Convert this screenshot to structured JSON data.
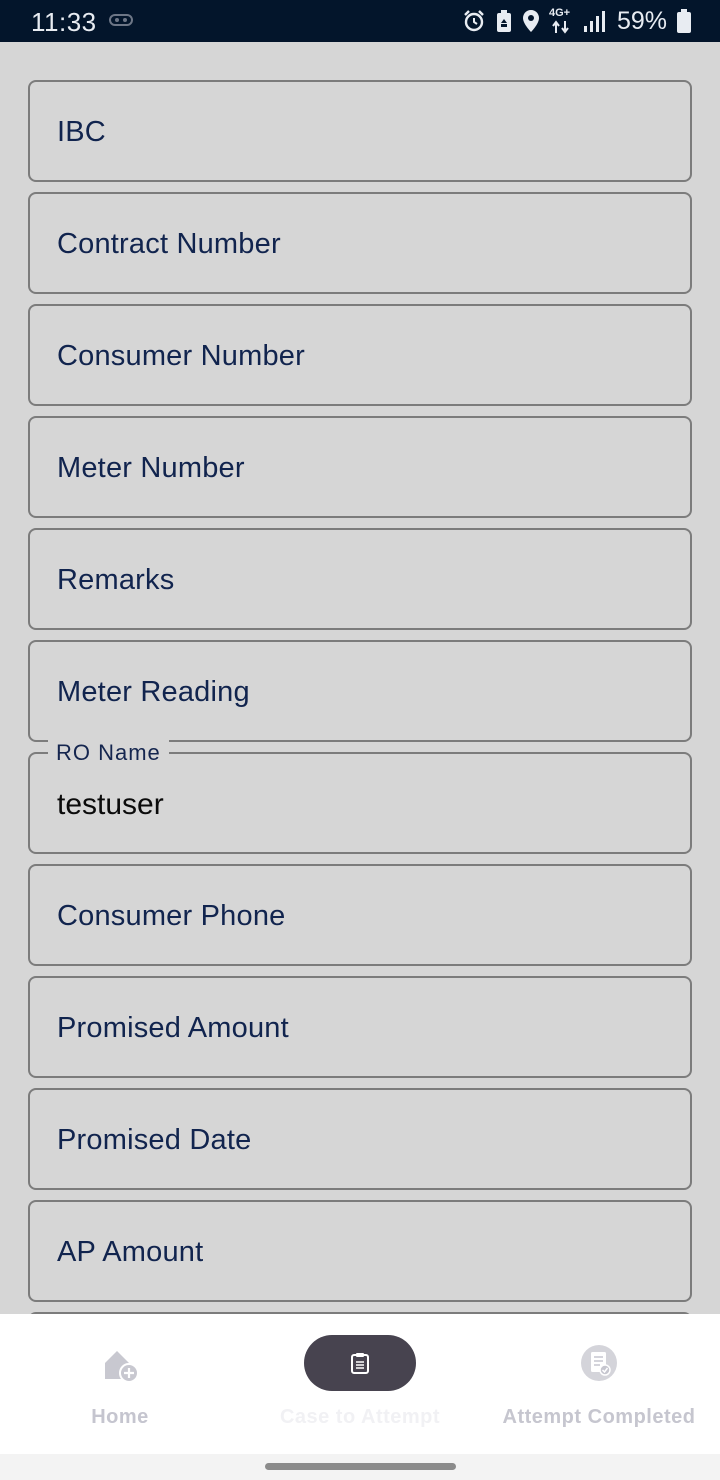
{
  "status_bar": {
    "time": "11:33",
    "network": "4G+",
    "battery_percent": "59%",
    "icons": [
      "notification-icon",
      "alarm-icon",
      "battery-saver-icon",
      "location-icon",
      "data-arrows-icon",
      "signal-icon",
      "battery-icon"
    ]
  },
  "form": {
    "fields": [
      {
        "placeholder": "IBC"
      },
      {
        "placeholder": "Contract Number"
      },
      {
        "placeholder": "Consumer Number"
      },
      {
        "placeholder": "Meter Number"
      },
      {
        "placeholder": "Remarks"
      },
      {
        "placeholder": "Meter Reading"
      },
      {
        "label": "RO Name",
        "value": "testuser"
      },
      {
        "placeholder": "Consumer Phone"
      },
      {
        "placeholder": "Promised Amount"
      },
      {
        "placeholder": "Promised Date"
      },
      {
        "placeholder": "AP Amount"
      }
    ]
  },
  "bottom_nav": {
    "items": [
      {
        "label": "Home",
        "icon": "home-add-icon",
        "active": false
      },
      {
        "label": "Case to Attempt",
        "icon": "clipboard-icon",
        "active": true
      },
      {
        "label": "Attempt Completed",
        "icon": "document-check-icon",
        "active": false
      }
    ]
  },
  "colors": {
    "status_bar_bg": "#03152b",
    "page_bg": "#d6d6d6",
    "field_text": "#11244e",
    "active_pill": "#47434f"
  }
}
